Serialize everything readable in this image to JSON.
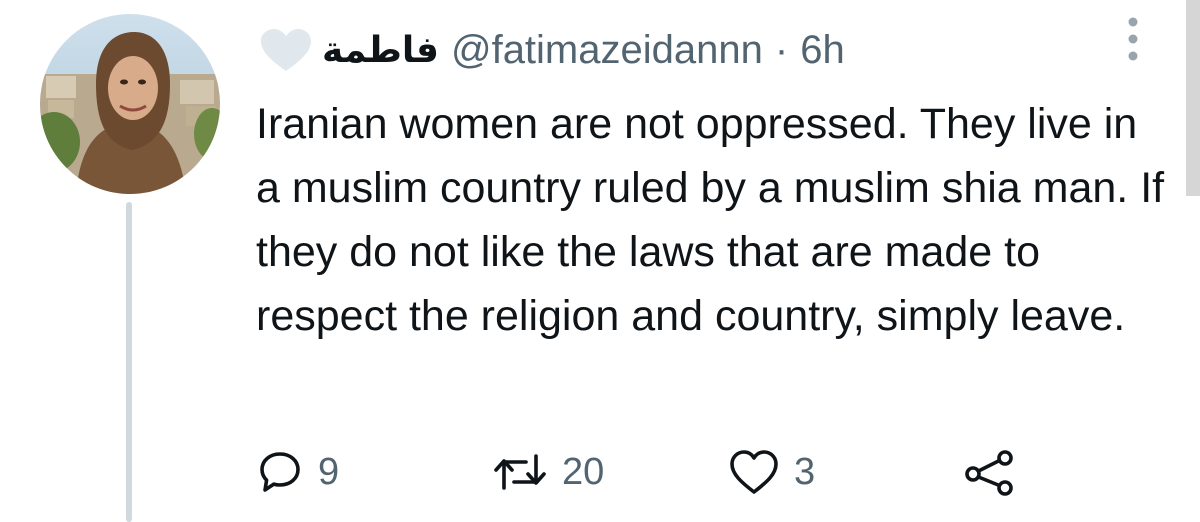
{
  "tweet": {
    "display_name": "فاطمة",
    "handle": "@fatimazeidannn",
    "separator": "·",
    "time": "6h",
    "text": "Iranian women are not oppressed. They live in a muslim country ruled by a muslim shia man. If they do not like the laws that are made to respect the religion and country, simply leave.",
    "avatar_icon": "profile-photo",
    "more_icon": "more-vertical-icon"
  },
  "actions": {
    "reply": {
      "icon": "reply-icon",
      "count": "9"
    },
    "retweet": {
      "icon": "retweet-icon",
      "count": "20"
    },
    "like": {
      "icon": "heart-icon",
      "count": "3"
    },
    "share": {
      "icon": "share-icon"
    }
  },
  "colors": {
    "text_primary": "#0f1419",
    "text_secondary": "#536471",
    "thread_line": "#cfd9de"
  }
}
